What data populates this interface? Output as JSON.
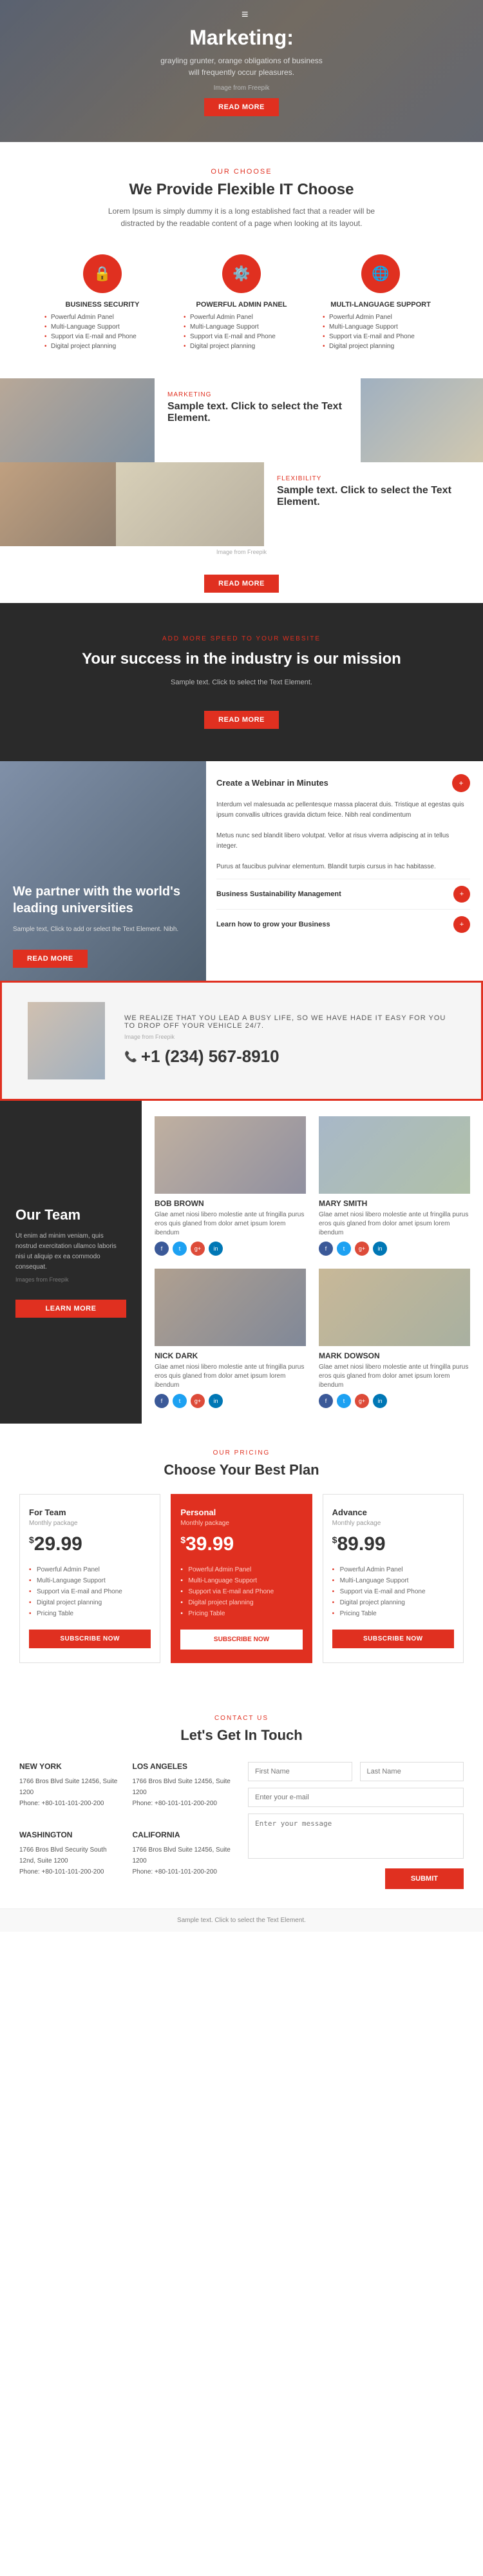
{
  "hero": {
    "hamburger": "≡",
    "title": "Marketing:",
    "subtitle": "grayling grunter, orange obligations of business will frequently occur pleasures.",
    "img_credit": "Image from Freepik",
    "btn_label": "READ MORE"
  },
  "choose": {
    "tag": "OUR CHOOSE",
    "title": "We Provide Flexible IT Choose",
    "desc": "Lorem Ipsum is simply dummy it is a long established fact that a reader will be distracted by the readable content of a page when looking at its layout.",
    "cards": [
      {
        "icon": "🔒",
        "title": "BUSINESS SECURITY",
        "items": [
          "Powerful Admin Panel",
          "Multi-Language Support",
          "Support via E-mail and Phone",
          "Digital project planning"
        ]
      },
      {
        "icon": "⚙️",
        "title": "POWERFUL ADMIN PANEL",
        "items": [
          "Powerful Admin Panel",
          "Multi-Language Support",
          "Support via E-mail and Phone",
          "Digital project planning"
        ]
      },
      {
        "icon": "🌐",
        "title": "MULTI-LANGUAGE SUPPORT",
        "items": [
          "Powerful Admin Panel",
          "Multi-Language Support",
          "Support via E-mail and Phone",
          "Digital project planning"
        ]
      }
    ]
  },
  "marketing": {
    "tag": "MARKETING",
    "title": "Sample text. Click to select the Text Element.",
    "img_credit_bottom": "Image from Freepik",
    "btn_label": "READ MORE"
  },
  "flexibility": {
    "tag": "FLEXIBILITY",
    "title": "Sample text. Click to select the Text Element.",
    "desc": ""
  },
  "mission": {
    "tag": "ADD MORE SPEED TO YOUR WEBSITE",
    "title": "Your success in the industry is our mission",
    "desc": "Sample text. Click to select the Text Element.",
    "btn_label": "READ MORE"
  },
  "universities": {
    "title": "We partner with the world's leading universities",
    "desc": "Sample text, Click to add or select the Text Element. Nibh.",
    "btn_label": "READ MORE",
    "webinar": {
      "title": "Create a Webinar in Minutes",
      "icon": "+",
      "body": "Interdum vel malesuada ac pellentesque massa placerat duis. Tristique at egestas quis ipsum convallis ultrices gravida dictum feice. Nibh real condimentum\n\nMetus nunc sed blandit libero volutpat. Vellor at risus viverra adipiscing at in tellus integer.\n\nPurus at faucibus pulvinar elementum. Blandit turpis cursus in hac habitasse.",
      "courses": [
        {
          "name": "Business Sustainability Management",
          "icon": "+"
        },
        {
          "name": "Learn how to grow your Business",
          "icon": "+"
        }
      ]
    }
  },
  "phone": {
    "realize": "WE REALIZE THAT YOU LEAD A BUSY LIFE, SO WE HAVE HADE IT EASY FOR YOU TO DROP OFF YOUR VEHICLE 24/7.",
    "img_credit": "Image from Freepik",
    "number": "+1 (234) 567-8910"
  },
  "team": {
    "tag": "",
    "title": "Our Team",
    "desc": "Ut enim ad minim veniam, quis nostrud exercitation ullamco laboris nisi ut aliquip ex ea commodo consequat.",
    "img_credit": "Images from Freepik",
    "btn_label": "LEARN MORE",
    "members": [
      {
        "name": "BOB BROWN",
        "bio": "Glae amet niosi libero molestie ante ut fringilla purus eros quis glaned from dolor amet ipsum lorem ibendum"
      },
      {
        "name": "MARY SMITH",
        "bio": "Glae amet niosi libero molestie ante ut fringilla purus eros quis glaned from dolor amet ipsum lorem ibendum"
      },
      {
        "name": "NICK DARK",
        "bio": "Glae amet niosi libero molestie ante ut fringilla purus eros quis glaned from dolor amet ipsum lorem ibendum"
      },
      {
        "name": "MARK DOWSON",
        "bio": "Glae amet niosi libero molestie ante ut fringilla purus eros quis glaned from dolor amet ipsum lorem ibendum"
      }
    ]
  },
  "pricing": {
    "tag": "OUR PRICING",
    "title": "Choose Your Best Plan",
    "plans": [
      {
        "name": "For Team",
        "monthly": "Monthly package",
        "price": "29.99",
        "currency": "$",
        "featured": false,
        "items": [
          "Powerful Admin Panel",
          "Multi-Language Support",
          "Support via E-mail and Phone",
          "Digital project planning",
          "Pricing Table"
        ],
        "btn": "SUBSCRIBE NOW"
      },
      {
        "name": "Personal",
        "monthly": "Monthly package",
        "price": "39.99",
        "currency": "$",
        "featured": true,
        "items": [
          "Powerful Admin Panel",
          "Multi-Language Support",
          "Support via E-mail and Phone",
          "Digital project planning",
          "Pricing Table"
        ],
        "btn": "SUBSCRIBE NOW"
      },
      {
        "name": "Advance",
        "monthly": "Monthly package",
        "price": "89.99",
        "currency": "$",
        "featured": false,
        "items": [
          "Powerful Admin Panel",
          "Multi-Language Support",
          "Support via E-mail and Phone",
          "Digital project planning",
          "Pricing Table"
        ],
        "btn": "SUBSCRIBE NOW"
      }
    ]
  },
  "contact": {
    "tag": "CONTACT US",
    "title": "Let's Get In Touch",
    "offices": [
      {
        "city": "NEW YORK",
        "address": "1766 Bros Blvd Suite 12456, Suite 1200",
        "phone": "Phone: +80-101-101-200-200"
      },
      {
        "city": "LOS ANGELES",
        "address": "1766 Bros Blvd Suite 12456, Suite 1200",
        "phone": "Phone: +80-101-101-200-200"
      },
      {
        "city": "WASHINGTON",
        "address": "1766 Bros Blvd Security South 12nd, Suite 1200",
        "phone": "Phone: +80-101-101-200-200"
      },
      {
        "city": "CALIFORNIA",
        "address": "1766 Bros Blvd Suite 12456, Suite 1200",
        "phone": "Phone: +80-101-101-200-200"
      }
    ],
    "form": {
      "first_name_placeholder": "First Name",
      "last_name_placeholder": "Last Name",
      "email_placeholder": "Enter your e-mail",
      "message_placeholder": "Enter your message",
      "btn_label": "SUBMIT"
    }
  },
  "footer": {
    "text": "Sample text. Click to select the Text Element."
  }
}
